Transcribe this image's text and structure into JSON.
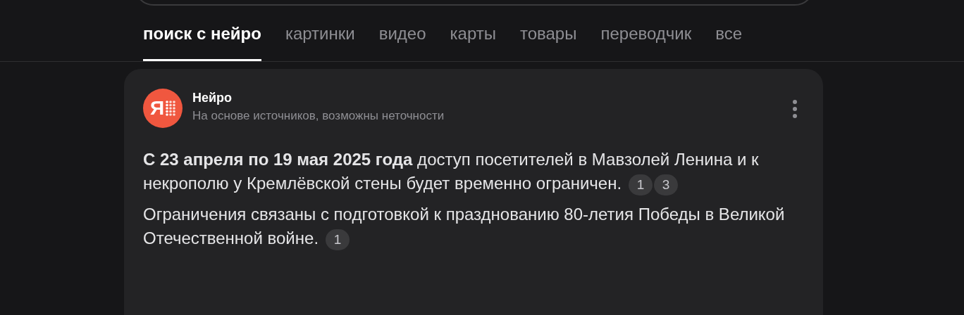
{
  "tabs": [
    {
      "label": "поиск с нейро",
      "selected": true
    },
    {
      "label": "картинки",
      "selected": false
    },
    {
      "label": "видео",
      "selected": false
    },
    {
      "label": "карты",
      "selected": false
    },
    {
      "label": "товары",
      "selected": false
    },
    {
      "label": "переводчик",
      "selected": false
    },
    {
      "label": "все",
      "selected": false
    }
  ],
  "answer": {
    "logo_glyph": "Я",
    "title": "Нейро",
    "subtitle": "На основе источников, возможны неточности",
    "paragraphs": [
      {
        "text": "**С 23 апреля по 19 мая 2025 года** доступ посетителей в Мавзолей Ленина и к некрополю у Кремлёвской стены будет временно ограничен.",
        "citations": [
          "1",
          "3"
        ]
      },
      {
        "text": "Ограничения связаны с подготовкой к празднованию 80-летия Победы в Великой Отечественной войне.",
        "citations": [
          "1"
        ]
      }
    ]
  }
}
